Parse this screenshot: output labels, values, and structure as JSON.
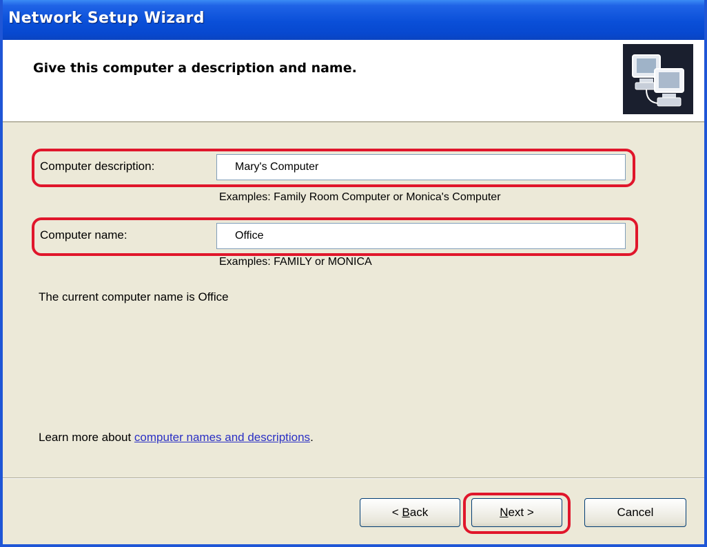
{
  "window": {
    "title": "Network Setup Wizard"
  },
  "header": {
    "heading": "Give this computer a description and name.",
    "icon": "network-computers-icon"
  },
  "form": {
    "description": {
      "label": "Computer description:",
      "value": "Mary's Computer",
      "examples": "Examples: Family Room Computer or Monica's Computer"
    },
    "name": {
      "label": "Computer name:",
      "value": "Office",
      "examples": "Examples: FAMILY or MONICA"
    },
    "current_name": "The current computer name is Office"
  },
  "learn_more": {
    "prefix": "Learn more about ",
    "link_text": "computer names and descriptions",
    "suffix": "."
  },
  "buttons": {
    "back": {
      "prefix": "< ",
      "accel": "B",
      "rest": "ack"
    },
    "next": {
      "accel": "N",
      "rest": "ext >"
    },
    "cancel": "Cancel"
  },
  "colors": {
    "title_bar": "#0a4fd8",
    "dialog_background": "#ece9d8",
    "highlight_annotation": "#e0162b",
    "link": "#2a2fc4"
  }
}
